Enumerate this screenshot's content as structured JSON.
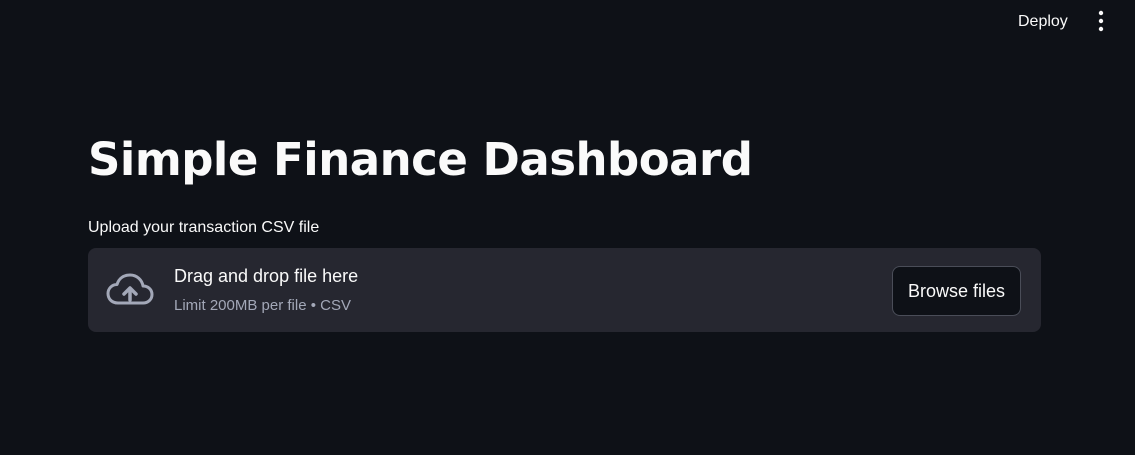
{
  "header": {
    "deploy_label": "Deploy",
    "menu_icon": "kebab-vertical-icon"
  },
  "main": {
    "title": "Simple Finance Dashboard",
    "uploader": {
      "label": "Upload your transaction CSV file",
      "drop_text": "Drag and drop file here",
      "limit_text": "Limit 200MB per file • CSV",
      "browse_label": "Browse files",
      "icon": "cloud-upload-icon"
    }
  },
  "colors": {
    "background": "#0e1117",
    "dropzone_bg": "#262730",
    "text": "#fafafa",
    "muted_text": "#a3a8b8",
    "icon": "#a3a8b8",
    "border": "#4a4d58"
  }
}
